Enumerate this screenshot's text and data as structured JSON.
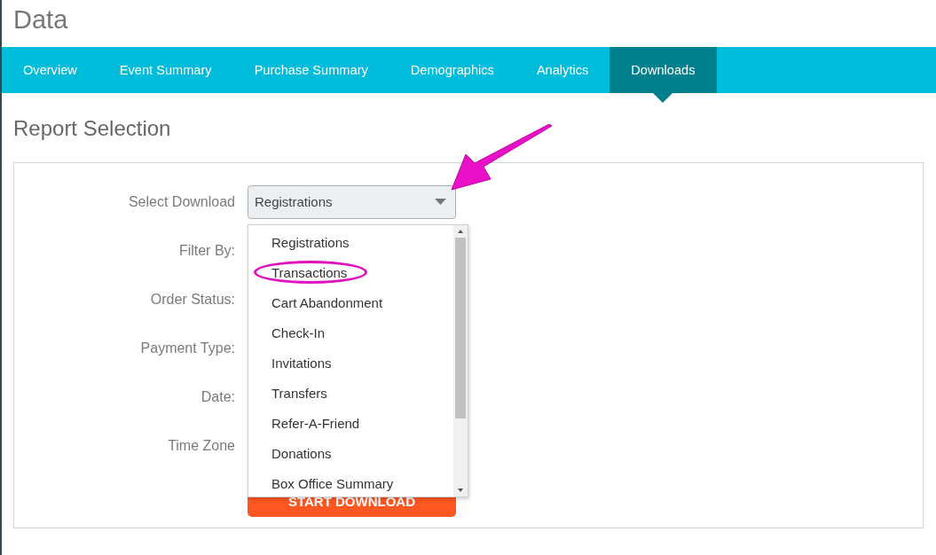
{
  "page_title": "Data",
  "tabs": [
    {
      "label": "Overview",
      "selected": false
    },
    {
      "label": "Event Summary",
      "selected": false
    },
    {
      "label": "Purchase Summary",
      "selected": false
    },
    {
      "label": "Demographics",
      "selected": false
    },
    {
      "label": "Analytics",
      "selected": false
    },
    {
      "label": "Downloads",
      "selected": true
    }
  ],
  "section_title": "Report Selection",
  "form": {
    "fields": [
      {
        "label": "Select Download"
      },
      {
        "label": "Filter By:"
      },
      {
        "label": "Order Status:"
      },
      {
        "label": "Payment Type:"
      },
      {
        "label": "Date:"
      },
      {
        "label": "Time Zone"
      }
    ],
    "select_value": "Registrations",
    "dropdown_options": [
      {
        "label": "Registrations",
        "circled": false
      },
      {
        "label": "Transactions",
        "circled": true
      },
      {
        "label": "Cart Abandonment",
        "circled": false
      },
      {
        "label": "Check-In",
        "circled": false
      },
      {
        "label": "Invitations",
        "circled": false
      },
      {
        "label": "Transfers",
        "circled": false
      },
      {
        "label": "Refer-A-Friend",
        "circled": false
      },
      {
        "label": "Donations",
        "circled": false
      },
      {
        "label": "Box Office Summary",
        "circled": false
      }
    ],
    "button": "START DOWNLOAD"
  }
}
